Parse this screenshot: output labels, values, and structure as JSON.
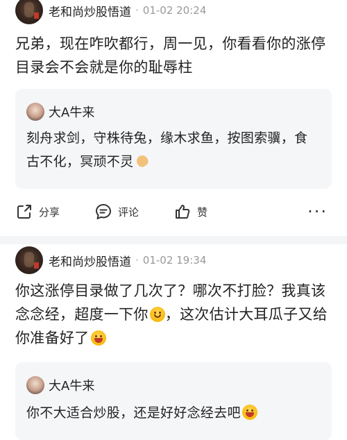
{
  "posts": [
    {
      "user": "老和尚炒股悟道",
      "separator": "·",
      "time": "01-02 20:24",
      "text": "兄弟，现在咋吹都行，周一见，你看看你的涨停目录会不会就是你的耻辱柱",
      "quote": {
        "user": "大A牛来",
        "text": "刻舟求剑，守株待兔，缘木求鱼，按图索骥，食古不化，冥顽不灵",
        "emoji": "pray-emoji"
      },
      "actions": {
        "share": "分享",
        "comment": "评论",
        "like": "赞",
        "more": "···"
      }
    },
    {
      "user": "老和尚炒股悟道",
      "separator": "·",
      "time": "01-02 19:34",
      "text_part1": "你这涨停目录做了几次了？哪次不打脸？我真该念念经，超度一下你",
      "text_part2": "，这次估计大耳瓜子又给你准备好了",
      "quote": {
        "user": "大A牛来",
        "text": "你不大适合炒股，还是好好念经去吧"
      }
    }
  ]
}
